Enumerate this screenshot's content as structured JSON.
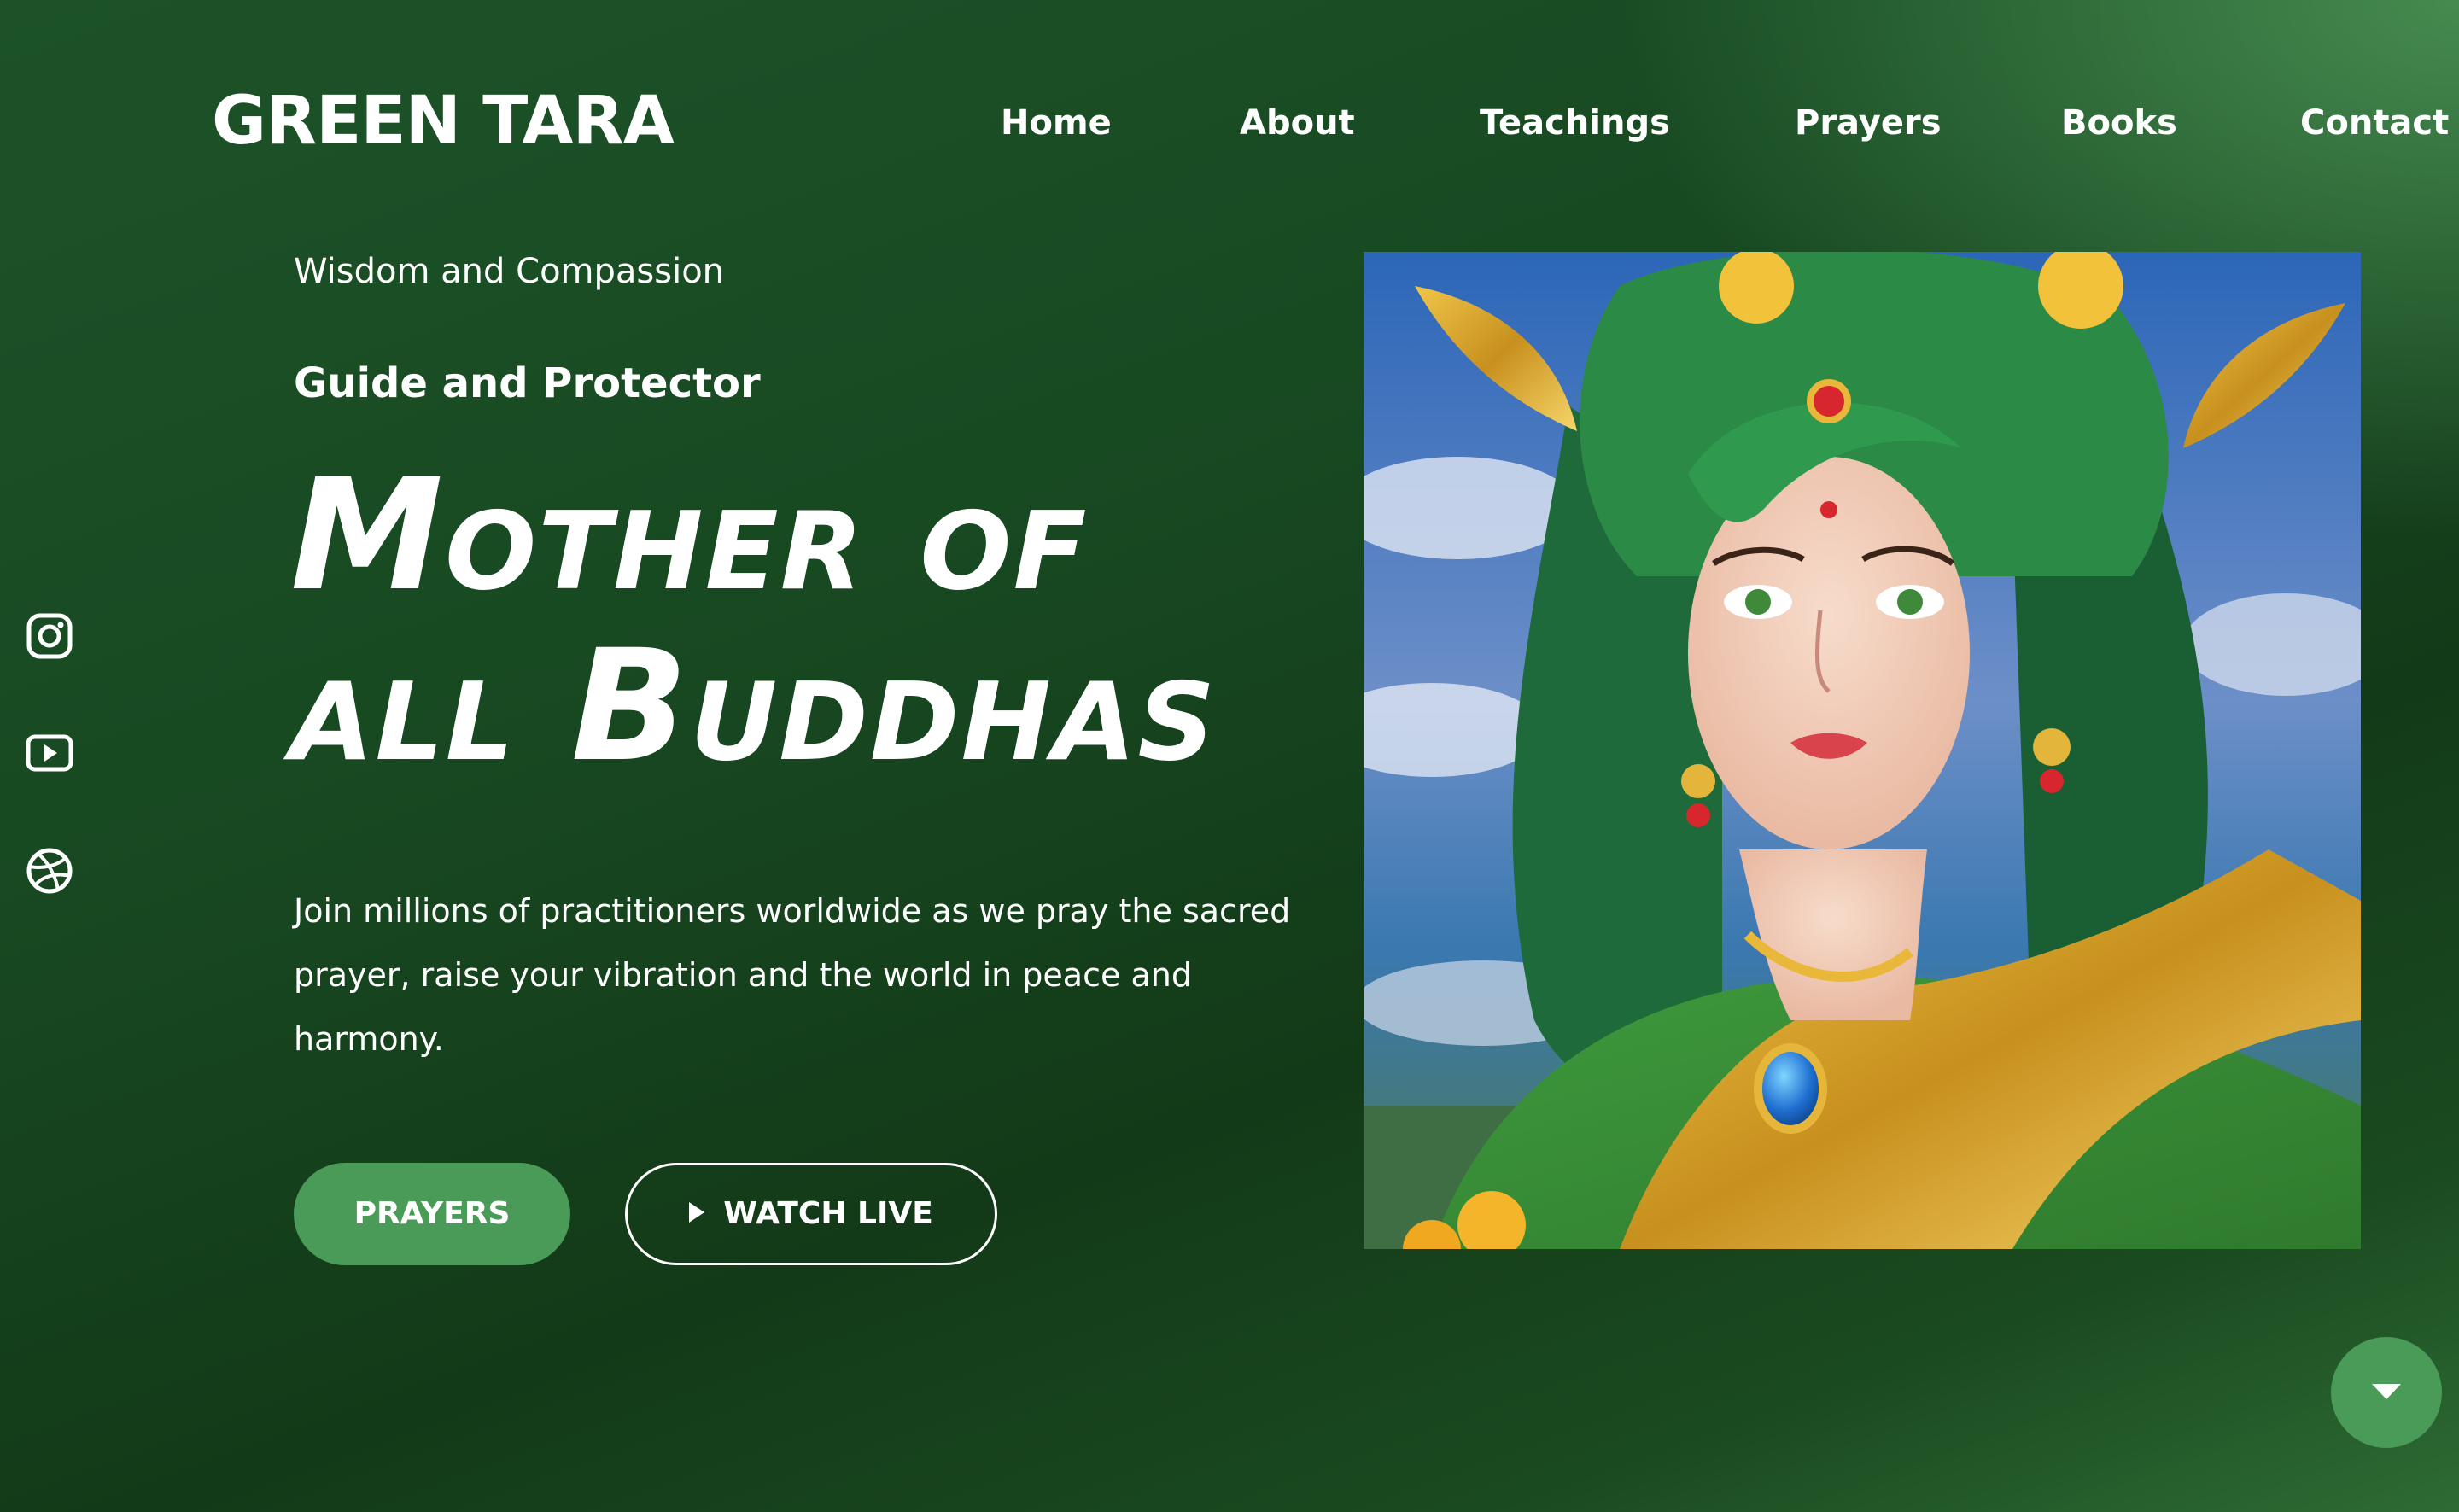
{
  "header": {
    "logo": "GREEN TARA",
    "nav": [
      {
        "label": "Home"
      },
      {
        "label": "About"
      },
      {
        "label": "Teachings"
      },
      {
        "label": "Prayers"
      },
      {
        "label": "Books"
      },
      {
        "label": "Contact"
      }
    ]
  },
  "social": [
    {
      "icon": "instagram-icon"
    },
    {
      "icon": "youtube-icon"
    },
    {
      "icon": "dribbble-icon"
    }
  ],
  "hero": {
    "eyebrow": "Wisdom and Compassion",
    "kicker": "Guide and Protector",
    "headline_line1": "Mother of",
    "headline_line2": "all Buddhas",
    "description": "Join millions of practitioners worldwide as we pray the sacred prayer, raise your vibration and the world in peace and harmony.",
    "primary_button": "PRAYERS",
    "secondary_button": "WATCH LIVE"
  },
  "scroll_button": {
    "icon": "chevron-down-icon"
  },
  "colors": {
    "background": "#184a22",
    "accent": "#4a9a58",
    "text": "#ffffff"
  }
}
